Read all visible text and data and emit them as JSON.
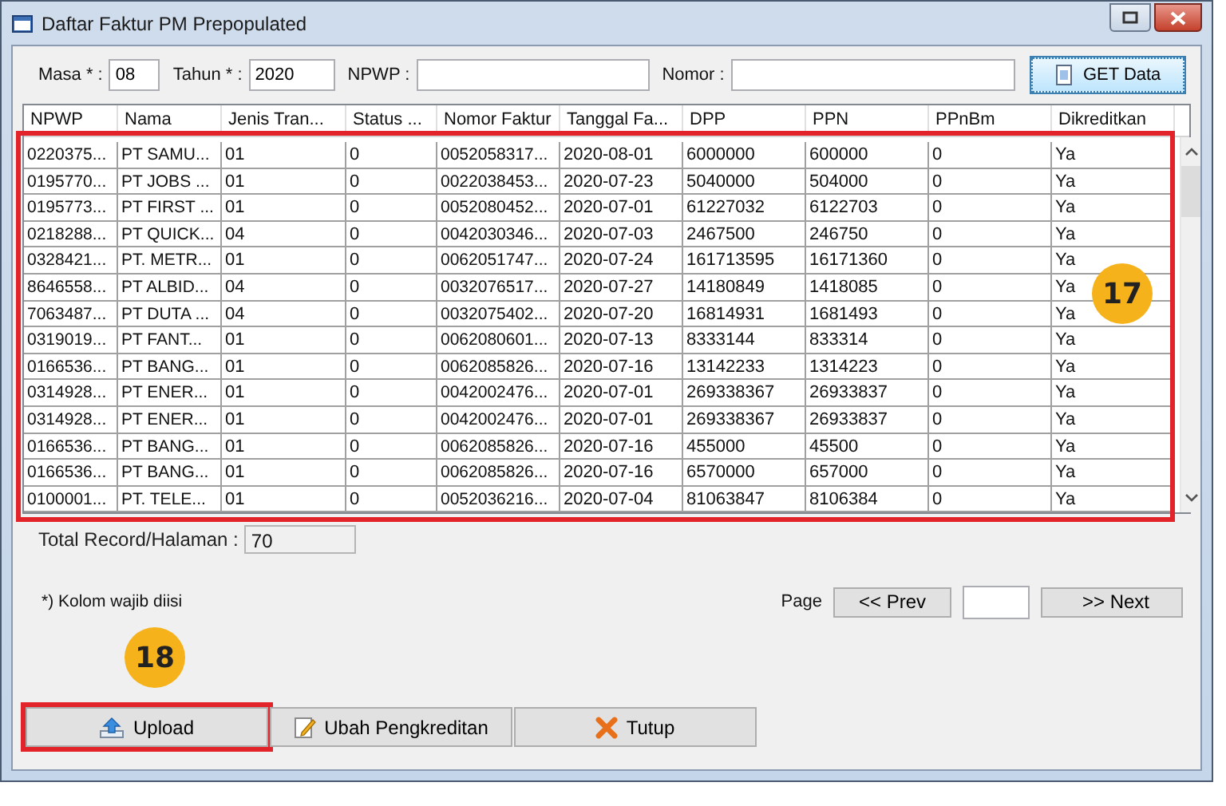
{
  "window": {
    "title": "Daftar Faktur PM Prepopulated"
  },
  "filters": [
    {
      "label": "Masa * :",
      "value": "08"
    },
    {
      "label": "Tahun * :",
      "value": "2020"
    },
    {
      "label": "NPWP :"
    },
    {
      "label": "Nomor :"
    }
  ],
  "get_button": "GET Data",
  "table": {
    "highlighted": true,
    "step": "17",
    "columns": [
      "NPWP",
      "Nama",
      "Jenis Tran...",
      "Status ...",
      "Nomor Faktur",
      "Tanggal Fa...",
      "DPP",
      "PPN",
      "PPnBm",
      "Dikreditkan"
    ],
    "rows": [
      [
        "0220375...",
        "PT SAMU...",
        "01",
        "0",
        "0052058317...",
        "2020-08-01",
        "6000000",
        "600000",
        "0",
        "Ya"
      ],
      [
        "0195770...",
        "PT JOBS ...",
        "01",
        "0",
        "0022038453...",
        "2020-07-23",
        "5040000",
        "504000",
        "0",
        "Ya"
      ],
      [
        "0195773...",
        "PT FIRST ...",
        "01",
        "0",
        "0052080452...",
        "2020-07-01",
        "61227032",
        "6122703",
        "0",
        "Ya"
      ],
      [
        "0218288...",
        "PT QUICK...",
        "04",
        "0",
        "0042030346...",
        "2020-07-03",
        "2467500",
        "246750",
        "0",
        "Ya"
      ],
      [
        "0328421...",
        "PT. METR...",
        "01",
        "0",
        "0062051747...",
        "2020-07-24",
        "161713595",
        "16171360",
        "0",
        "Ya"
      ],
      [
        "8646558...",
        "PT ALBID...",
        "04",
        "0",
        "0032076517...",
        "2020-07-27",
        "14180849",
        "1418085",
        "0",
        "Ya"
      ],
      [
        "7063487...",
        "PT DUTA ...",
        "04",
        "0",
        "0032075402...",
        "2020-07-20",
        "16814931",
        "1681493",
        "0",
        "Ya"
      ],
      [
        "0319019...",
        "PT FANT...",
        "01",
        "0",
        "0062080601...",
        "2020-07-13",
        "8333144",
        "833314",
        "0",
        "Ya"
      ],
      [
        "0166536...",
        "PT BANG...",
        "01",
        "0",
        "0062085826...",
        "2020-07-16",
        "13142233",
        "1314223",
        "0",
        "Ya"
      ],
      [
        "0314928...",
        "PT ENER...",
        "01",
        "0",
        "0042002476...",
        "2020-07-01",
        "269338367",
        "26933837",
        "0",
        "Ya"
      ],
      [
        "0314928...",
        "PT ENER...",
        "01",
        "0",
        "0042002476...",
        "2020-07-01",
        "269338367",
        "26933837",
        "0",
        "Ya"
      ],
      [
        "0166536...",
        "PT BANG...",
        "01",
        "0",
        "0062085826...",
        "2020-07-16",
        "455000",
        "45500",
        "0",
        "Ya"
      ],
      [
        "0166536...",
        "PT BANG...",
        "01",
        "0",
        "0062085826...",
        "2020-07-16",
        "6570000",
        "657000",
        "0",
        "Ya"
      ],
      [
        "0100001...",
        "PT. TELE...",
        "01",
        "0",
        "0052036216...",
        "2020-07-04",
        "81063847",
        "8106384",
        "0",
        "Ya"
      ]
    ]
  },
  "total": {
    "label": "Total Record/Halaman :",
    "value": "70"
  },
  "note": "*) Kolom wajib diisi",
  "pager": {
    "label": "Page",
    "prev": "<< Prev",
    "next": ">> Next"
  },
  "buttons": [
    {
      "kind": "upload",
      "label": "Upload",
      "highlighted": true,
      "step": "18"
    },
    {
      "kind": "edit",
      "label": "Ubah Pengkreditan"
    },
    {
      "kind": "close",
      "label": "Tutup"
    }
  ]
}
